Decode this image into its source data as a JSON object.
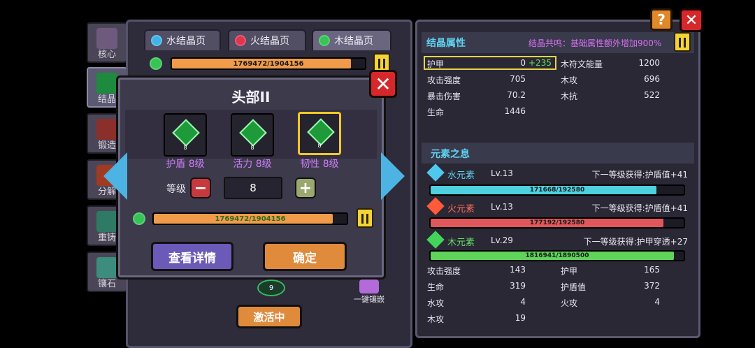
{
  "side_tabs": [
    {
      "label": "核心",
      "icon": "core-icon"
    },
    {
      "label": "结晶",
      "icon": "crystal-icon"
    },
    {
      "label": "锻造",
      "icon": "forge-icon"
    },
    {
      "label": "分解",
      "icon": "decompose-icon"
    },
    {
      "label": "重铸",
      "icon": "recast-icon"
    },
    {
      "label": "镶石",
      "icon": "inlay-icon"
    }
  ],
  "tabs": [
    {
      "label": "水结晶页",
      "gem": "blue"
    },
    {
      "label": "火结晶页",
      "gem": "red"
    },
    {
      "label": "木结晶页",
      "gem": "green",
      "active": true
    }
  ],
  "top_bar": {
    "text": "1769472/1904156",
    "fraction": 0.929
  },
  "popup": {
    "title": "头部II",
    "slots": [
      {
        "label": "护盾 8级",
        "lv": "8"
      },
      {
        "label": "活力 8级",
        "lv": "8"
      },
      {
        "label": "韧性 8级",
        "lv": "8",
        "selected": true
      }
    ],
    "level_label": "等级",
    "level_value": "8",
    "minus": "−",
    "plus": "+",
    "bar": {
      "text": "1769472/1904156",
      "fraction": 0.929
    },
    "view_details": "查看详情",
    "confirm": "确定",
    "close": "✕"
  },
  "behind": {
    "slot_number": "9",
    "one_click": "一键镶嵌",
    "activating": "激活中"
  },
  "right": {
    "help": "?",
    "close": "✕",
    "crystal_title": "结晶属性",
    "resonance": "结晶共鸣：基础属性额外增加900%",
    "stats": [
      {
        "name": "护甲",
        "value": "0",
        "bonus": "+235"
      },
      {
        "name": "攻击强度",
        "value": "705"
      },
      {
        "name": "暴击伤害",
        "value": "70.2"
      },
      {
        "name": "生命",
        "value": "1446"
      }
    ],
    "stats_right": [
      {
        "name": "木符文能量",
        "value": "1200"
      },
      {
        "name": "木攻",
        "value": "696"
      },
      {
        "name": "木抗",
        "value": "522"
      }
    ],
    "element_title": "元素之息",
    "elements": [
      {
        "name": "水元素",
        "lv": "Lv.13",
        "next": "下一等级获得:护盾值+41",
        "bar": "171668/192580",
        "fraction": 0.891,
        "color": "#4fd0de",
        "name_color": "#5fd1ee",
        "icon": "water-element-icon"
      },
      {
        "name": "火元素",
        "lv": "Lv.13",
        "next": "下一等级获得:护盾值+41",
        "bar": "177192/192580",
        "fraction": 0.92,
        "color": "#e0575b",
        "name_color": "#ff6b5a",
        "icon": "fire-element-icon"
      },
      {
        "name": "木元素",
        "lv": "Lv.29",
        "next": "下一等级获得:护甲穿透+27",
        "bar": "1816941/1890500",
        "fraction": 0.961,
        "color": "#5fd35a",
        "name_color": "#66e06a",
        "icon": "wood-element-icon"
      }
    ],
    "bottom_stats_left": [
      {
        "name": "攻击强度",
        "value": "143"
      },
      {
        "name": "生命",
        "value": "319"
      },
      {
        "name": "水攻",
        "value": "4"
      },
      {
        "name": "木攻",
        "value": "19"
      }
    ],
    "bottom_stats_right": [
      {
        "name": "护甲",
        "value": "165"
      },
      {
        "name": "护盾值",
        "value": "372"
      },
      {
        "name": "火攻",
        "value": "4"
      }
    ]
  }
}
